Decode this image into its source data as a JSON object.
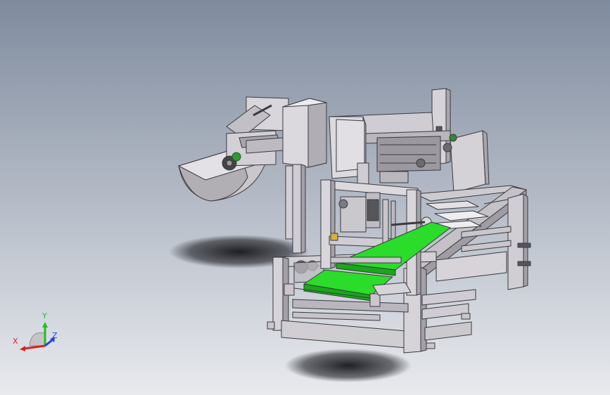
{
  "viewport": {
    "background_top": "#7f8b9e",
    "background_bottom": "#e8eaee"
  },
  "model": {
    "metal_color": "#dcd9de",
    "metal_shadow": "#a9a6ad",
    "edge_color": "#3a3a40",
    "belt_color": "#2bdc2b",
    "belt_dark": "#18a818"
  },
  "triad": {
    "x_label": "X",
    "y_label": "Y",
    "z_label": "Z",
    "x_color": "#e02020",
    "y_color": "#20c020",
    "z_color": "#2040e0"
  }
}
